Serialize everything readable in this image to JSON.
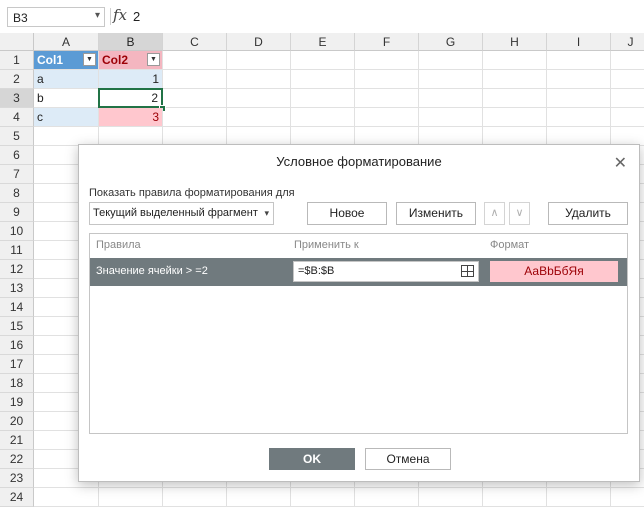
{
  "formula_bar": {
    "cell_ref": "B3",
    "fx": "fx",
    "value": "2"
  },
  "columns": [
    "A",
    "B",
    "C",
    "D",
    "E",
    "F",
    "G",
    "H",
    "I",
    "J"
  ],
  "rows": [
    "1",
    "2",
    "3",
    "4",
    "5",
    "6",
    "7",
    "8",
    "9",
    "10",
    "11",
    "12",
    "13",
    "14",
    "15",
    "16",
    "17",
    "18",
    "19",
    "20",
    "21",
    "22",
    "23",
    "24"
  ],
  "table": {
    "header": [
      "Col1",
      "Col2"
    ],
    "data": [
      [
        "a",
        "1"
      ],
      [
        "b",
        "2"
      ],
      [
        "c",
        "3"
      ]
    ]
  },
  "dialog": {
    "title": "Условное форматирование",
    "show_rules_label": "Показать правила форматирования для",
    "scope_value": "Текущий выделенный фрагмент",
    "new_button": "Новое",
    "edit_button": "Изменить",
    "delete_button": "Удалить",
    "col_rules": "Правила",
    "col_apply": "Применить к",
    "col_format": "Формат",
    "rule": {
      "text": "Значение ячейки > =2",
      "apply_to": "=$B:$B",
      "preview": "АаВbБбЯя"
    },
    "ok_button": "OK",
    "cancel_button": "Отмена"
  },
  "colors": {
    "table_header": "#5b9bd5",
    "band": "#ddebf7",
    "highlight_fill": "#ffc7ce",
    "highlight_text": "#9c0006",
    "selection": "#217346",
    "rule_row": "#707a7e"
  }
}
